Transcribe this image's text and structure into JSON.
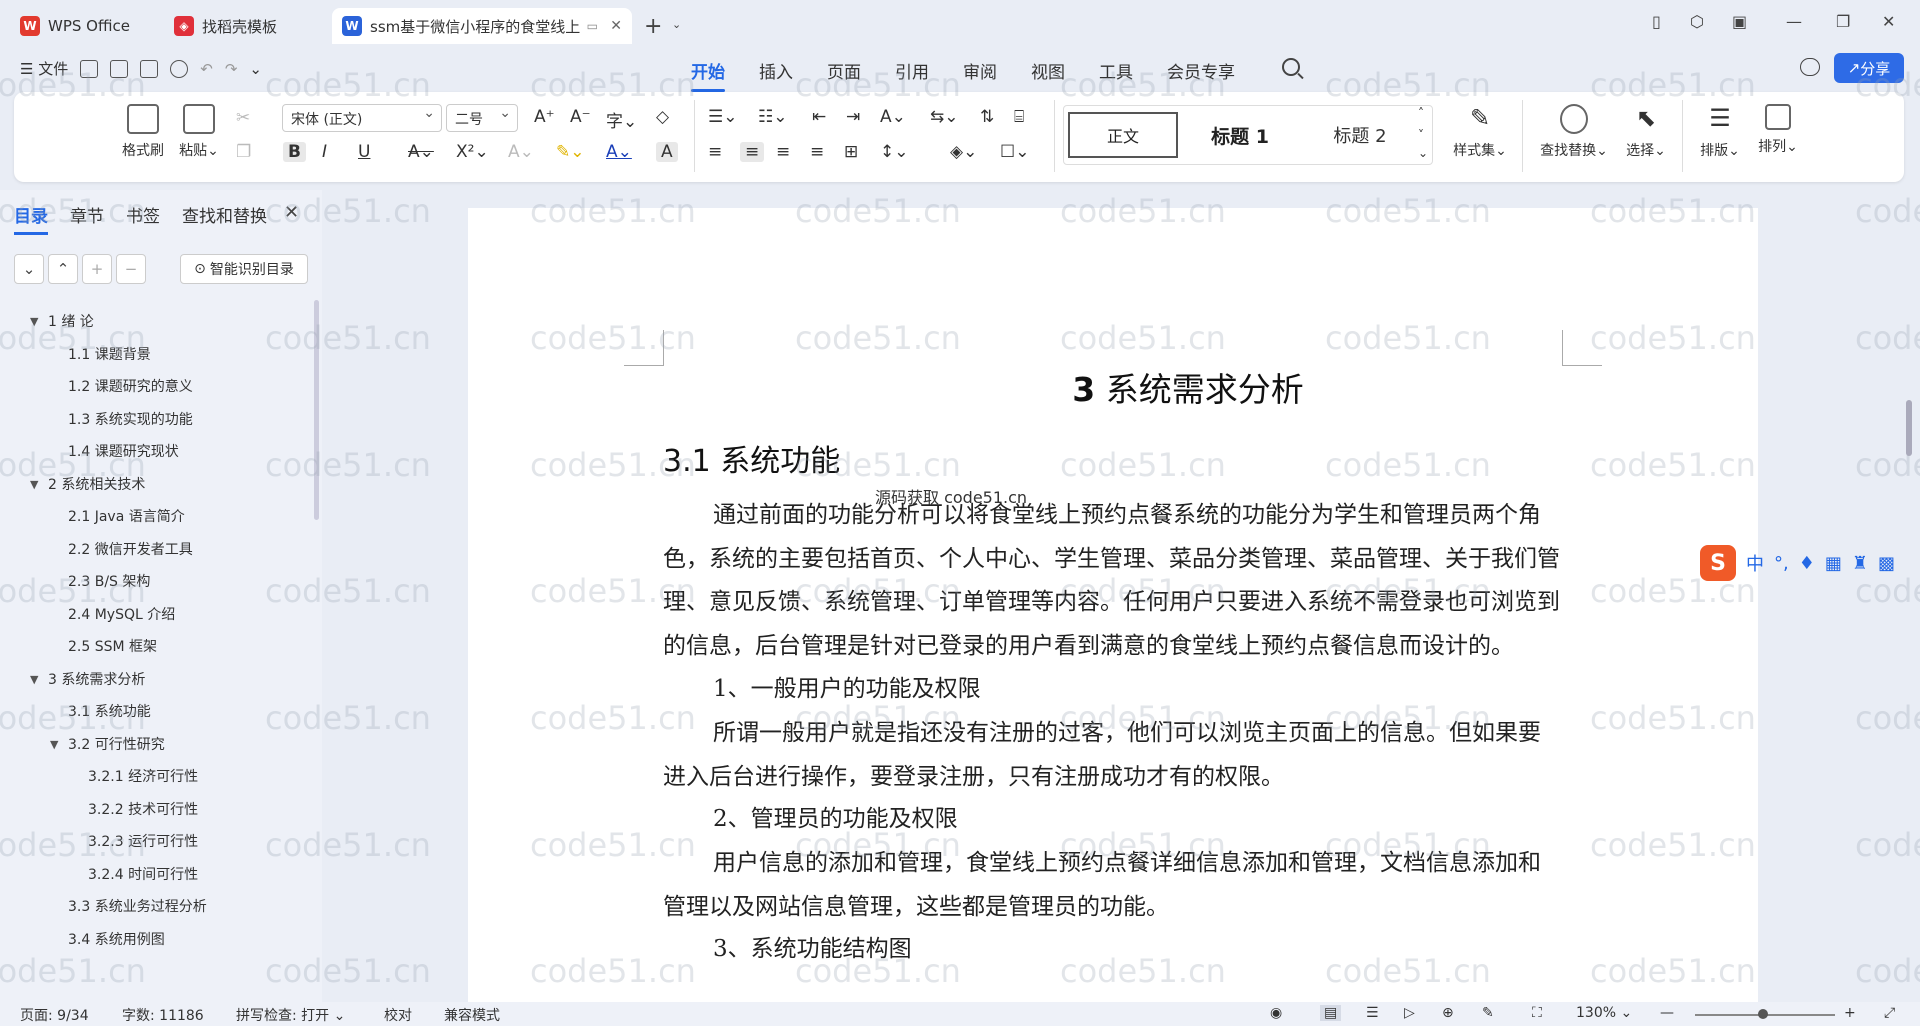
{
  "tabs": [
    {
      "label": "WPS Office",
      "icon": "wps-logo-icon",
      "active": false
    },
    {
      "label": "找稻壳模板",
      "icon": "docer-logo-icon",
      "active": false
    },
    {
      "label": "ssm基于微信小程序的食堂线上",
      "icon": "word-doc-icon",
      "active": true
    }
  ],
  "menu": {
    "file_label": "文件",
    "tabs": [
      "开始",
      "插入",
      "页面",
      "引用",
      "审阅",
      "视图",
      "工具",
      "会员专享"
    ],
    "active_tab": "开始",
    "share_label": "分享"
  },
  "ribbon": {
    "format_painter": "格式刷",
    "paste": "粘贴",
    "font_name": "宋体 (正文)",
    "font_size": "二号",
    "bold": "B",
    "italic": "I",
    "underline": "U",
    "style_normal": "正文",
    "style_h1": "标题 1",
    "style_h2": "标题 2",
    "style_set": "样式集",
    "find_replace": "查找替换",
    "select": "选择",
    "layout": "排版",
    "arrange": "排列"
  },
  "nav_panel": {
    "tabs": [
      "目录",
      "章节",
      "书签",
      "查找和替换"
    ],
    "active_tab": "目录",
    "smart_toc": "智能识别目录",
    "toc": [
      {
        "label": "1 绪  论",
        "level": 1,
        "expanded": true
      },
      {
        "label": "1.1  课题背景",
        "level": 2
      },
      {
        "label": "1.2  课题研究的意义",
        "level": 2
      },
      {
        "label": "1.3  系统实现的功能",
        "level": 2
      },
      {
        "label": "1.4  课题研究现状",
        "level": 2
      },
      {
        "label": "2 系统相关技术",
        "level": 1,
        "expanded": true
      },
      {
        "label": "2.1 Java 语言简介",
        "level": 2
      },
      {
        "label": "2.2 微信开发者工具",
        "level": 2
      },
      {
        "label": "2.3 B/S 架构",
        "level": 2
      },
      {
        "label": "2.4 MySQL  介绍",
        "level": 2
      },
      {
        "label": "2.5 SSM 框架",
        "level": 2
      },
      {
        "label": "3 系统需求分析",
        "level": 1,
        "expanded": true
      },
      {
        "label": "3.1 系统功能",
        "level": 2
      },
      {
        "label": "3.2 可行性研究",
        "level": 2,
        "expanded": true
      },
      {
        "label": "3.2.1  经济可行性",
        "level": 3
      },
      {
        "label": "3.2.2  技术可行性",
        "level": 3
      },
      {
        "label": "3.2.3  运行可行性",
        "level": 3
      },
      {
        "label": "3.2.4  时间可行性",
        "level": 3
      },
      {
        "label": "3.3 系统业务过程分析",
        "level": 2
      },
      {
        "label": "3.4 系统用例图",
        "level": 2
      }
    ]
  },
  "document": {
    "chapter_num": "3",
    "chapter_title": "系统需求分析",
    "section_title": "3.1 系统功能",
    "overlay_text": "源码获取 code51.cn",
    "paragraphs": [
      "通过前面的功能分析可以将食堂线上预约点餐系统的功能分为学生和管理员两个角色，系统的主要包括首页、个人中心、学生管理、菜品分类管理、菜品管理、关于我们管理、意见反馈、系统管理、订单管理等内容。任何用户只要进入系统不需登录也可浏览到的信息，后台管理是针对已登录的用户看到满意的食堂线上预约点餐信息而设计的。",
      "1、一般用户的功能及权限",
      "所谓一般用户就是指还没有注册的过客，他们可以浏览主页面上的信息。但如果要进入后台进行操作，要登录注册，只有注册成功才有的权限。",
      "2、管理员的功能及权限",
      "用户信息的添加和管理，食堂线上预约点餐详细信息添加和管理，文档信息添加和管理以及网站信息管理，这些都是管理员的功能。",
      "3、系统功能结构图"
    ],
    "watermark": "code51.cn"
  },
  "ime": {
    "lang": "中"
  },
  "status": {
    "page": "页面: 9/34",
    "words": "字数: 11186",
    "spell": "拼写检查: 打开",
    "proof": "校对",
    "compat": "兼容模式",
    "zoom": "130%"
  }
}
